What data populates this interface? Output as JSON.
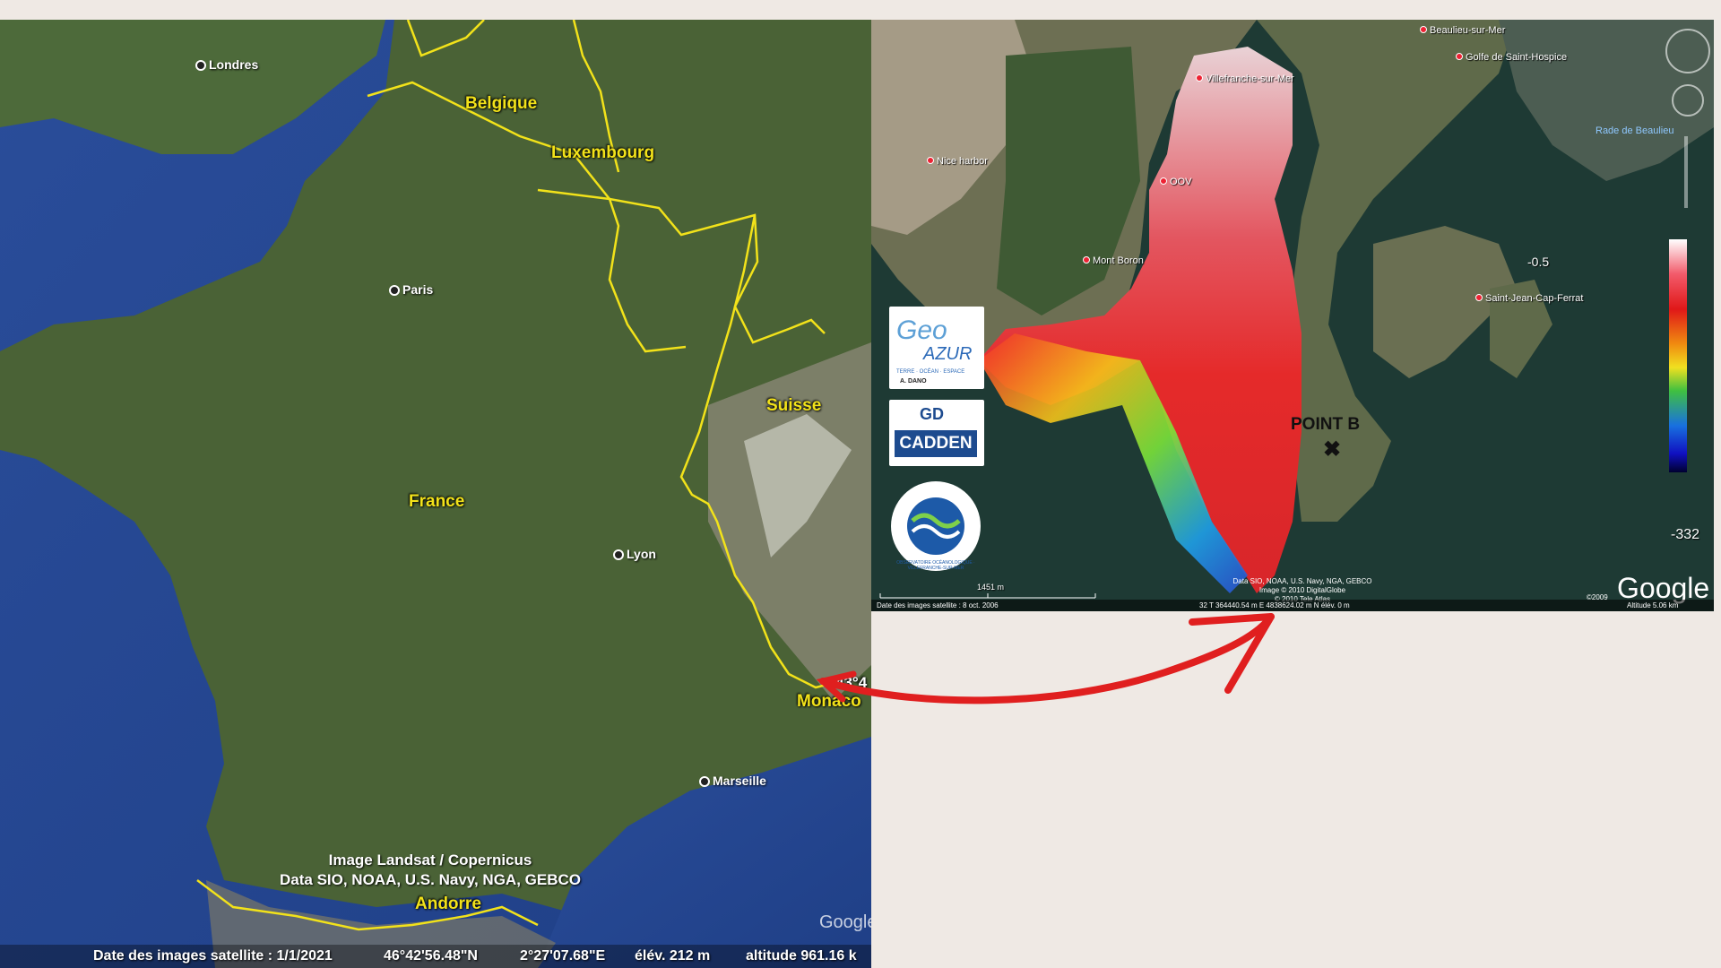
{
  "left_map": {
    "countries": [
      "Belgique",
      "Luxembourg",
      "Suisse",
      "France",
      "Monaco",
      "Andorre"
    ],
    "cities": [
      "Londres",
      "Paris",
      "Lyon",
      "Marseille"
    ],
    "credit_line1": "Image Landsat / Copernicus",
    "credit_line2": "Data SIO, NOAA, U.S. Navy, NGA, GEBCO",
    "watermark": "Google",
    "coord_clip": "43°4",
    "status": {
      "date": "Date des images satellite : 1/1/2021",
      "lat": "46°42'56.48\"N",
      "lon": "2°27'07.68\"E",
      "elev": "élév.  212 m",
      "alt": "altitude 961.16 k"
    }
  },
  "right_map": {
    "places": [
      "Beaulieu-sur-Mer",
      "Golfe de Saint-Hospice",
      "Villefranche-sur-Mer",
      "Nice harbor",
      "OOV",
      "Mont Boron",
      "Saint-Jean-Cap-Ferrat"
    ],
    "sea_label": "Rade de Beaulieu",
    "point_label": "POINT B",
    "point_marker": "✖",
    "colorbar": {
      "max": "-0.5",
      "min": "-332"
    },
    "scale": "1451 m",
    "credits": [
      "Data SIO, NOAA, U.S. Navy, NGA, GEBCO",
      "Image © 2010 DigitalGlobe",
      "© 2010 Tele Atlas"
    ],
    "copyright_year": "©2009",
    "watermark": "Google",
    "logos": {
      "geoazur_geo": "Geo",
      "geoazur_azur": "AZUR",
      "geoazur_sub": "TERRE · OCÉAN · ESPACE",
      "geoazur_author": "A. DANO",
      "gd": "GD",
      "cadden": "CADDEN",
      "observatoire": "OBSERVATOIRE OCÉANOLOGIQUE · VILLEFRANCHE-SUR-MER"
    },
    "status": {
      "date": "Date des images satellite :  8 oct. 2006",
      "coords": "32 T 364440.54 m E 4838624.02 m N   élév.    0 m",
      "alt": "Altitude     5.06 km"
    }
  },
  "colors": {
    "border": "#f2e21a",
    "arrow": "#e01f1f",
    "background": "#efe9e4"
  }
}
